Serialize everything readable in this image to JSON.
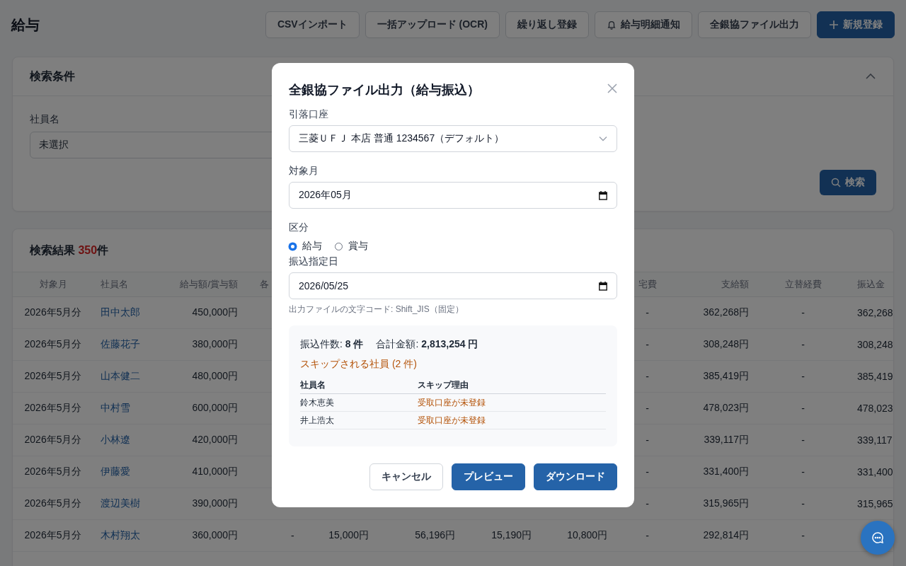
{
  "page": {
    "title": "給与"
  },
  "toolbar": [
    {
      "label": "CSVインポート",
      "kind": "default"
    },
    {
      "label": "一括アップロード (OCR)",
      "kind": "default"
    },
    {
      "label": "繰り返し登録",
      "kind": "default"
    },
    {
      "label": "給与明細通知",
      "kind": "default"
    },
    {
      "label": "全銀協ファイル出力",
      "kind": "default"
    },
    {
      "label": "新規登録",
      "kind": "primary"
    }
  ],
  "search_panel": {
    "title": "検索条件",
    "expanded": true,
    "employee_label": "社員名",
    "employee_value": "未選択",
    "search_button": "検索"
  },
  "results": {
    "title": "検索結果",
    "count": "350",
    "count_suffix": "件",
    "table": {
      "headers": {
        "month": "対象月",
        "name": "社員名",
        "pay": "給与額/賞与額",
        "column_4": "各",
        "housing": "宅費",
        "total": "支給額",
        "advance": "立替経費",
        "transfer": "振込金"
      },
      "rows": [
        {
          "month": "2026年5月分",
          "name": "田中太郎",
          "pay": "450,000円",
          "housing": "-",
          "total": "362,268円",
          "advance": "-",
          "transfer": "362,268"
        },
        {
          "month": "2026年5月分",
          "name": "佐藤花子",
          "pay": "380,000円",
          "housing": "-",
          "total": "308,248円",
          "advance": "-",
          "transfer": "308,248"
        },
        {
          "month": "2026年5月分",
          "name": "山本健二",
          "pay": "480,000円",
          "housing": "-",
          "total": "385,419円",
          "advance": "-",
          "transfer": "385,419"
        },
        {
          "month": "2026年5月分",
          "name": "中村雪",
          "pay": "600,000円",
          "housing": "-",
          "total": "478,023円",
          "advance": "-",
          "transfer": "478,023"
        },
        {
          "month": "2026年5月分",
          "name": "小林遼",
          "pay": "420,000円",
          "housing": "-",
          "total": "339,117円",
          "advance": "-",
          "transfer": "339,117"
        },
        {
          "month": "2026年5月分",
          "name": "伊藤愛",
          "pay": "410,000円",
          "housing": "-",
          "total": "331,400円",
          "advance": "-",
          "transfer": "331,400"
        },
        {
          "month": "2026年5月分",
          "name": "渡辺美樹",
          "pay": "390,000円",
          "housing": "-",
          "total": "315,965円",
          "advance": "-",
          "transfer": "315,965"
        },
        {
          "month": "2026年5月分",
          "name": "木村翔太",
          "pay": "360,000円",
          "column_4": "-",
          "column_5": "15,000円",
          "column_6": "56,196円",
          "column_7": "15,190円",
          "column_8": "10,800円",
          "housing": "-",
          "total": "292,814円",
          "advance": "-"
        }
      ]
    }
  },
  "dialog": {
    "title": "全銀協ファイル出力（給与振込）",
    "account": {
      "label": "引落口座",
      "value": "三菱ＵＦＪ 本店 普通 1234567（デフォルト）"
    },
    "month": {
      "label": "対象月",
      "value": "2026年05月"
    },
    "category": {
      "label": "区分",
      "options": [
        {
          "label": "給与",
          "selected": true
        },
        {
          "label": "賞与",
          "selected": false
        }
      ]
    },
    "date": {
      "label": "振込指定日",
      "value": "2026/05/25"
    },
    "hint": "出力ファイルの文字コード: Shift_JIS（固定）",
    "summary": {
      "count": "振込件数: **8 件**",
      "amount": "合計金額: **2,813,254 円**",
      "skip_title": "スキップされる社員 (2 件)",
      "skip_columns": [
        "社員名",
        "スキップ理由"
      ],
      "skip_rows": [
        {
          "name": "鈴木恵美",
          "reason": "受取口座が未登録"
        },
        {
          "name": "井上浩太",
          "reason": "受取口座が未登録"
        }
      ]
    },
    "buttons": [
      {
        "label": "キャンセル",
        "kind": "default"
      },
      {
        "label": "プレビュー",
        "kind": "primary"
      },
      {
        "label": "ダウンロード",
        "kind": "primary"
      }
    ]
  }
}
